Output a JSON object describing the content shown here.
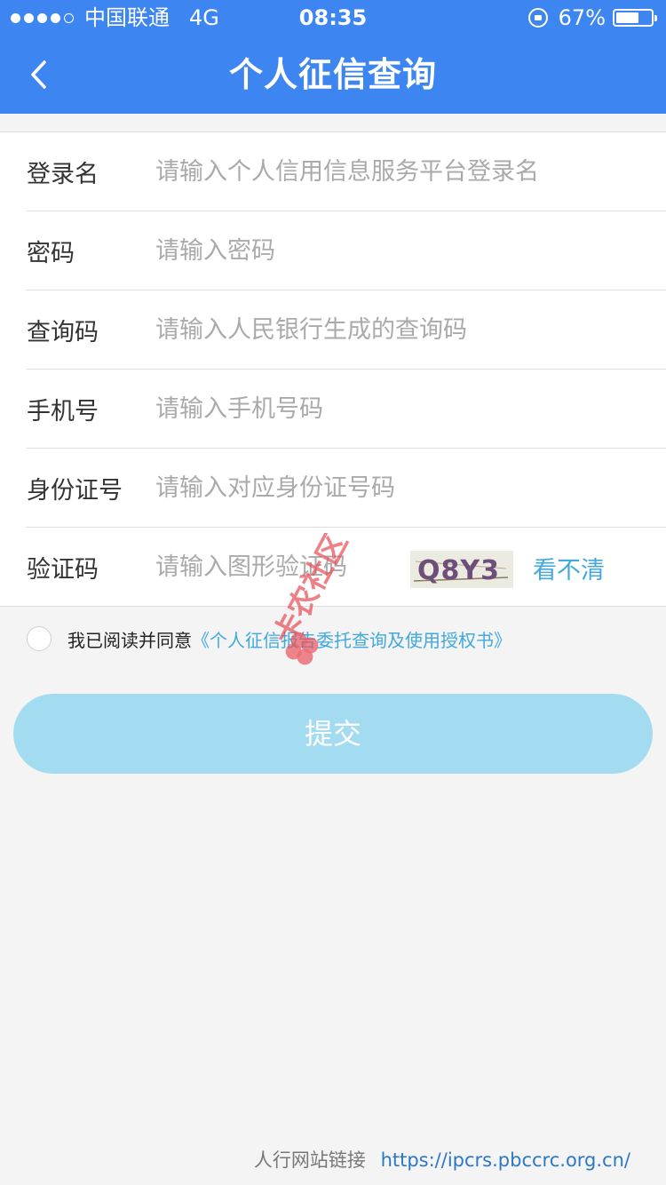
{
  "status_bar": {
    "carrier": "中国联通",
    "network": "4G",
    "time": "08:35",
    "battery": "67%",
    "battery_level": 0.67
  },
  "nav": {
    "title": "个人征信查询"
  },
  "form": {
    "rows": [
      {
        "label": "登录名",
        "placeholder": "请输入个人信用信息服务平台登录名",
        "value": ""
      },
      {
        "label": "密码",
        "placeholder": "请输入密码",
        "value": ""
      },
      {
        "label": "查询码",
        "placeholder": "请输入人民银行生成的查询码",
        "value": ""
      },
      {
        "label": "手机号",
        "placeholder": "请输入手机号码",
        "value": ""
      },
      {
        "label": "身份证号",
        "placeholder": "请输入对应身份证号码",
        "value": ""
      },
      {
        "label": "验证码",
        "placeholder": "请输入图形验证码",
        "value": ""
      }
    ],
    "captcha_text": "Q8Y3",
    "captcha_refresh": "看不清"
  },
  "agreement": {
    "text": "我已阅读并同意",
    "link": "《个人征信报告委托查询及使用授权书》"
  },
  "submit_label": "提交",
  "footer": {
    "label": "人行网站链接",
    "link": "https://ipcrs.pbccrc.org.cn/"
  },
  "watermark": "卡农社区",
  "colors": {
    "primary": "#3d86f1",
    "link": "#41a9dd",
    "submit_disabled": "#a3dcf0",
    "watermark": "#e8515a"
  }
}
